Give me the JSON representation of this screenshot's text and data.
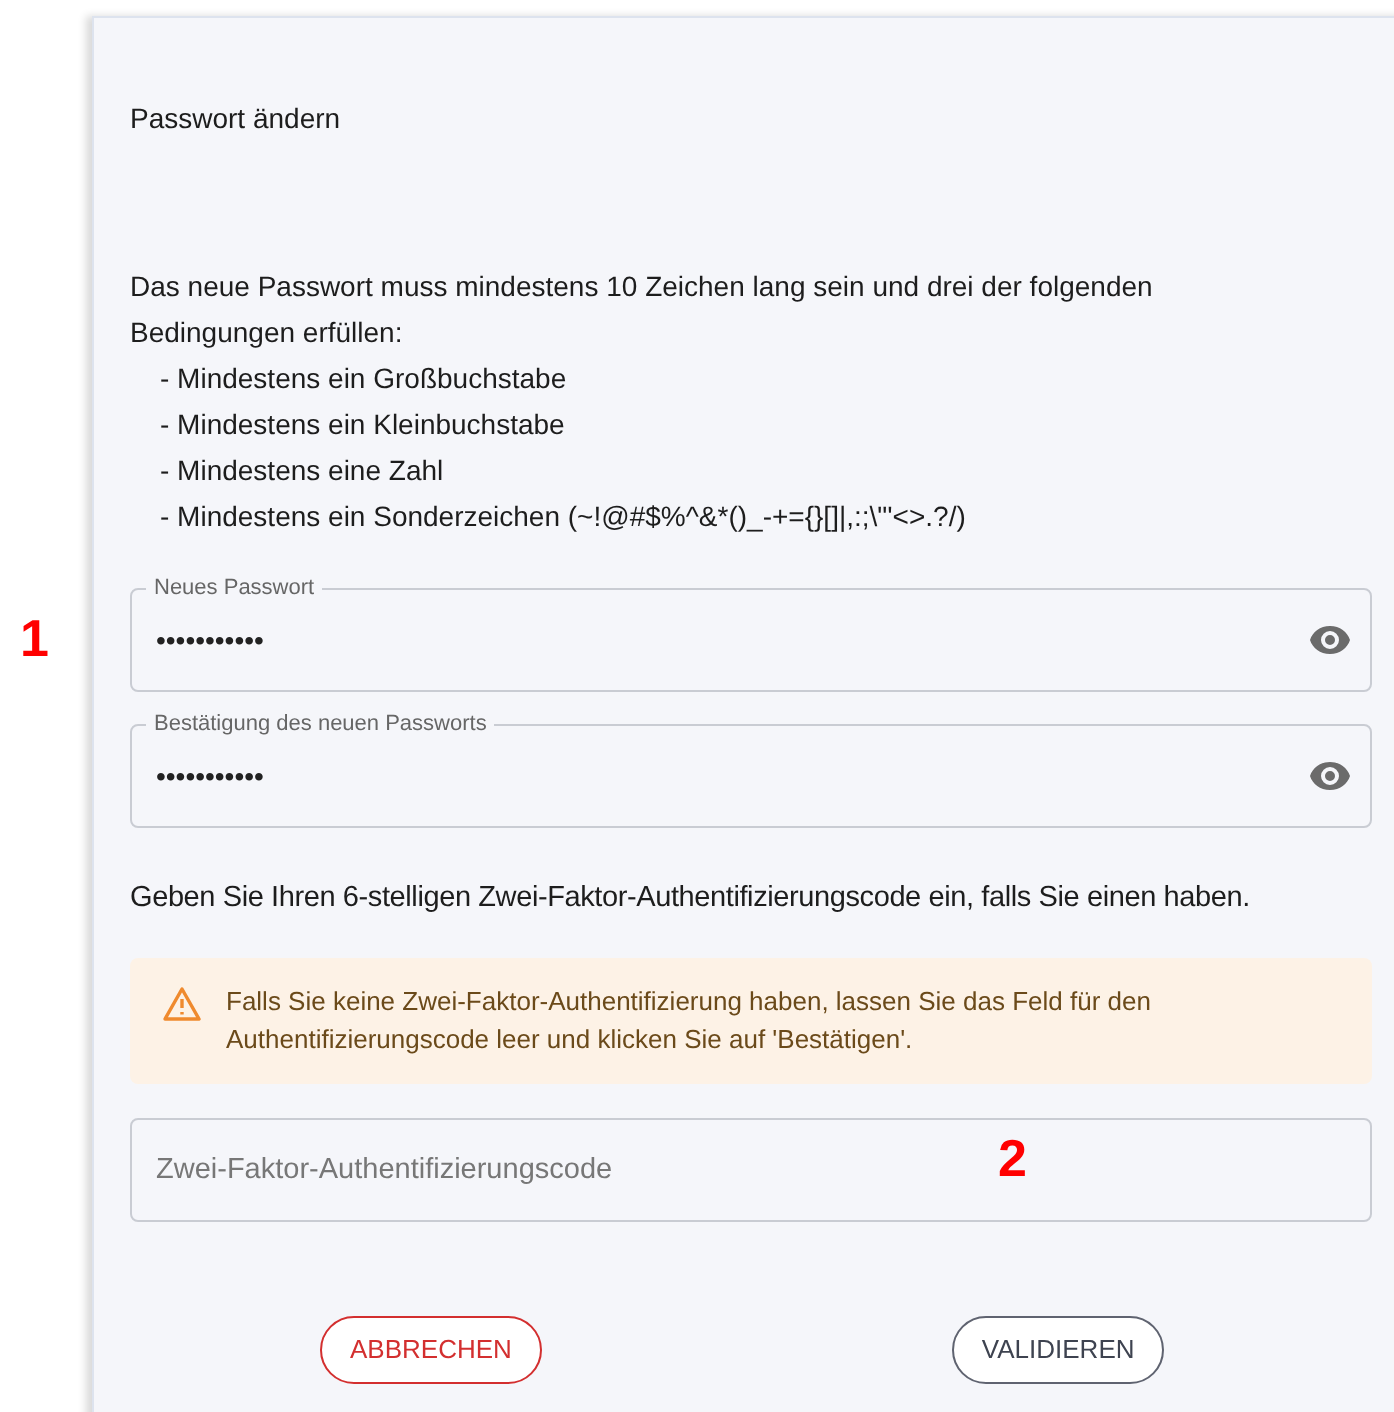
{
  "annotations": [
    {
      "label": "1"
    },
    {
      "label": "2"
    }
  ],
  "dialog": {
    "title": "Passwort ändern",
    "rules_intro": "Das neue Passwort muss mindestens 10 Zeichen lang sein und drei der folgenden Bedingungen erfüllen:",
    "rules": [
      "- Mindestens ein Großbuchstabe",
      "- Mindestens ein Kleinbuchstabe",
      "- Mindestens eine Zahl",
      "- Mindestens ein Sonderzeichen (~!@#$%^&*()_-+={}[]|,:;\\\"'<>.?/)"
    ],
    "password_fields": [
      {
        "label": "Neues Passwort",
        "value": "•••••••••••"
      },
      {
        "label": "Bestätigung des neuen Passworts",
        "value": "•••••••••••"
      }
    ],
    "two_factor_prompt": "Geben Sie Ihren 6-stelligen Zwei-Faktor-Authentifizierungscode ein, falls Sie einen haben.",
    "warning": "Falls Sie keine Zwei-Faktor-Authentifizierung haben, lassen Sie das Feld für den Authentifizierungscode leer und klicken Sie auf 'Bestätigen'.",
    "code_field": {
      "placeholder": "Zwei-Faktor-Authentifizierungscode"
    },
    "buttons": [
      {
        "label": "ABBRECHEN",
        "kind": "cancel"
      },
      {
        "label": "VALIDIEREN",
        "kind": "confirm"
      }
    ]
  }
}
